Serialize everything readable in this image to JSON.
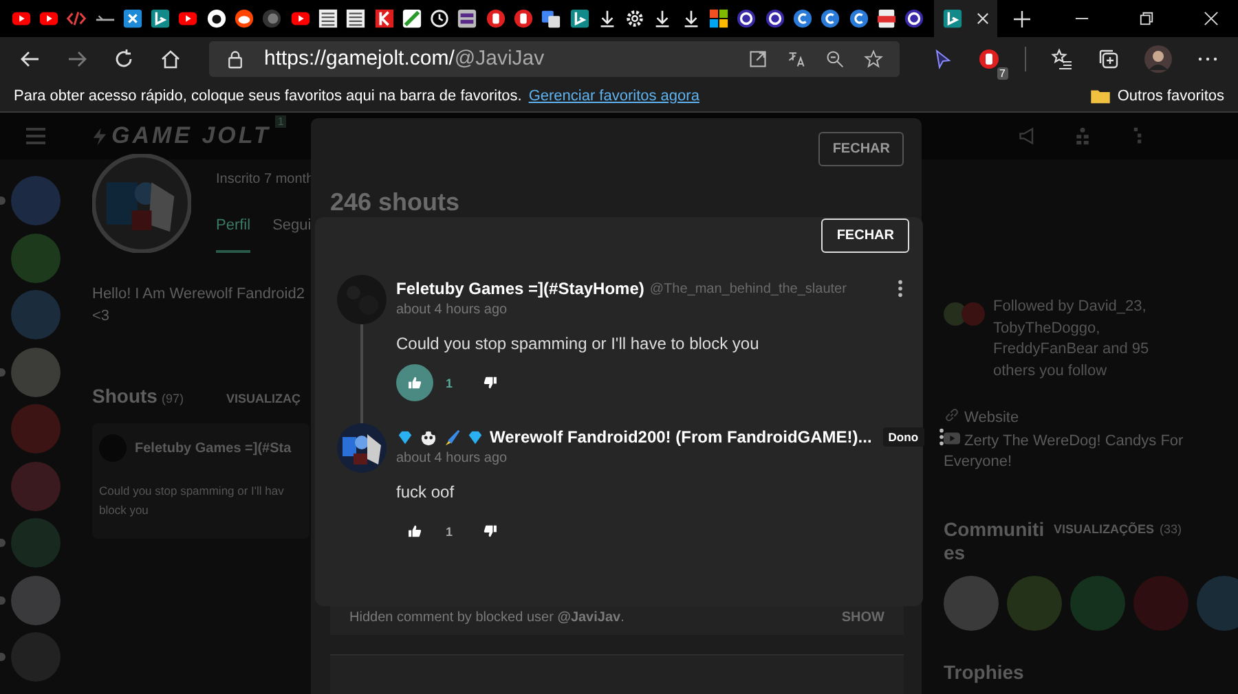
{
  "browser": {
    "tabs": [
      {
        "kind": "youtube",
        "selected": false
      },
      {
        "kind": "youtube",
        "selected": false
      },
      {
        "kind": "code",
        "selected": false
      },
      {
        "kind": "dash",
        "selected": false
      },
      {
        "kind": "box",
        "selected": false
      },
      {
        "kind": "bing",
        "selected": false
      },
      {
        "kind": "youtube",
        "selected": false
      },
      {
        "kind": "github",
        "selected": false
      },
      {
        "kind": "reddit",
        "selected": false
      },
      {
        "kind": "disc",
        "selected": false
      },
      {
        "kind": "youtube",
        "selected": false
      },
      {
        "kind": "grid",
        "selected": false
      },
      {
        "kind": "grid",
        "selected": false
      },
      {
        "kind": "red-square",
        "selected": false
      },
      {
        "kind": "pen",
        "selected": false
      },
      {
        "kind": "clock",
        "selected": false
      },
      {
        "kind": "gray-square",
        "selected": false
      },
      {
        "kind": "stop",
        "selected": false
      },
      {
        "kind": "stop",
        "selected": false
      },
      {
        "kind": "translate",
        "selected": false
      },
      {
        "kind": "bing",
        "selected": false
      },
      {
        "kind": "download",
        "selected": false
      },
      {
        "kind": "gear",
        "selected": false
      },
      {
        "kind": "download",
        "selected": false
      },
      {
        "kind": "download",
        "selected": false
      },
      {
        "kind": "windows",
        "selected": false
      },
      {
        "kind": "ring",
        "selected": false
      },
      {
        "kind": "ring",
        "selected": false
      },
      {
        "kind": "c-circle",
        "selected": false
      },
      {
        "kind": "c-circle",
        "selected": false
      },
      {
        "kind": "c-circle",
        "selected": false
      },
      {
        "kind": "pdf",
        "selected": false
      },
      {
        "kind": "ring",
        "selected": false
      },
      {
        "kind": "bing",
        "selected": true
      }
    ],
    "address": {
      "host": "https://gamejolt.com/",
      "path": "@JaviJav"
    },
    "extension_badge": "7",
    "favorites_bar": {
      "message": "Para obter acesso rápido, coloque seus favoritos aqui na barra de favoritos.",
      "link": "Gerenciar favoritos agora",
      "other": "Outros favoritos"
    }
  },
  "site": {
    "logo": "GAME JOLT",
    "notification_count": "1",
    "sidebar": [
      {
        "color": "#1c2a44",
        "dot": true
      },
      {
        "color": "#1e3a1c",
        "dot": false
      },
      {
        "color": "#1b2c3c",
        "dot": false
      },
      {
        "color": "#3c3c38",
        "dot": true
      },
      {
        "color": "#3c1414",
        "dot": false
      },
      {
        "color": "#3a1a1e",
        "dot": false
      },
      {
        "color": "#182a20",
        "dot": true
      },
      {
        "color": "#3a3a3c",
        "dot": true
      },
      {
        "color": "#222222",
        "dot": true
      }
    ],
    "profile": {
      "joined": "Inscrito 7 month",
      "tabs": [
        {
          "label": "Perfil",
          "selected": true
        },
        {
          "label": "Segui",
          "selected": false
        }
      ],
      "bio": [
        "Hello! I Am Werewolf Fandroid2",
        "<3"
      ]
    },
    "shouts": {
      "title": "Shouts",
      "count": "(97)",
      "view_all": "VISUALIZAÇ",
      "card": {
        "author": "Feletuby Games =](#Sta",
        "text": [
          "Could you stop spamming or I'll hav",
          "block you"
        ]
      }
    },
    "right": {
      "followed_by": "Followed by David_23, TobyTheDoggo, FreddyFanBear and 95 others you follow",
      "links": [
        {
          "kind": "link",
          "label": "Website"
        },
        {
          "kind": "youtube",
          "label": "Zerty The WereDog! Candys For Everyone!"
        }
      ],
      "communities": {
        "title": "Communities",
        "view_all": "VISUALIZAÇÕES",
        "count": "(33)",
        "items": [
          {
            "color": "#3a3a3a"
          },
          {
            "color": "#24321a"
          },
          {
            "color": "#14321e"
          },
          {
            "color": "#2e0e10"
          },
          {
            "color": "#1a2c38"
          }
        ]
      },
      "trophies": "Trophies"
    }
  },
  "shouts_modal": {
    "close": "FECHAR",
    "title": "246 shouts",
    "hidden": {
      "text": "Hidden comment by blocked user **@JaviJav**.",
      "action": "SHOW"
    }
  },
  "thread_modal": {
    "close": "FECHAR",
    "comments": [
      {
        "kind": "plain",
        "author": "Feletuby Games =](#StayHome)",
        "username": "@The_man_behind_the_slauter",
        "time": "about 4 hours ago",
        "text": "Could you stop spamming or I'll have to block you",
        "likes": "1",
        "liked": true
      },
      {
        "kind": "flair",
        "author": "Werewolf Fandroid200! (From FandroidGAME!)...",
        "owner_badge": "Dono",
        "time": "about 4 hours ago",
        "text": "fuck oof",
        "likes": "1",
        "liked": false
      }
    ]
  }
}
